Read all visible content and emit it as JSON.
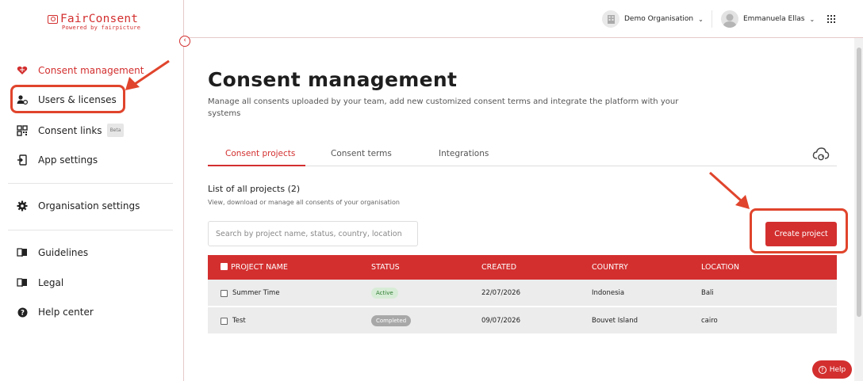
{
  "brand": {
    "name": "FairConsent",
    "tagline": "Powered by fairpicture",
    "accent": "#d32f2f"
  },
  "sidebar": {
    "collapse_glyph": "‹",
    "items": [
      {
        "label": "Consent management",
        "icon": "shield-heart-icon",
        "active": true
      },
      {
        "label": "Users & licenses",
        "icon": "users-icon"
      },
      {
        "label": "Consent links",
        "icon": "qr-code-icon",
        "badge": "Beta"
      },
      {
        "label": "App settings",
        "icon": "app-settings-icon"
      },
      {
        "label": "Organisation settings",
        "icon": "gear-icon"
      },
      {
        "label": "Guidelines",
        "icon": "book-icon"
      },
      {
        "label": "Legal",
        "icon": "legal-book-icon"
      },
      {
        "label": "Help center",
        "icon": "help-icon"
      }
    ]
  },
  "topbar": {
    "org_name": "Demo Organisation",
    "user_name": "Emmanuela Ellas"
  },
  "main": {
    "title": "Consent management",
    "description": "Manage all consents uploaded by your team, add new customized consent terms and integrate the platform with your systems",
    "tabs": [
      {
        "label": "Consent projects",
        "active": true
      },
      {
        "label": "Consent terms"
      },
      {
        "label": "Integrations"
      }
    ],
    "list_title": "List of all projects (2)",
    "list_subtitle": "View, download or manage all consents of your organisation",
    "search_placeholder": "Search by project name, status, country, location",
    "create_button": "Create project"
  },
  "table": {
    "columns": [
      "PROJECT NAME",
      "STATUS",
      "CREATED",
      "COUNTRY",
      "LOCATION"
    ],
    "rows": [
      {
        "name": "Summer Time",
        "status": "Active",
        "created": "22/07/2026",
        "country": "Indonesia",
        "location": "Bali"
      },
      {
        "name": "Test",
        "status": "Completed",
        "created": "09/07/2026",
        "country": "Bouvet Island",
        "location": "cairo"
      }
    ]
  },
  "help_button": "Help",
  "annotation_color": "#e0442c"
}
